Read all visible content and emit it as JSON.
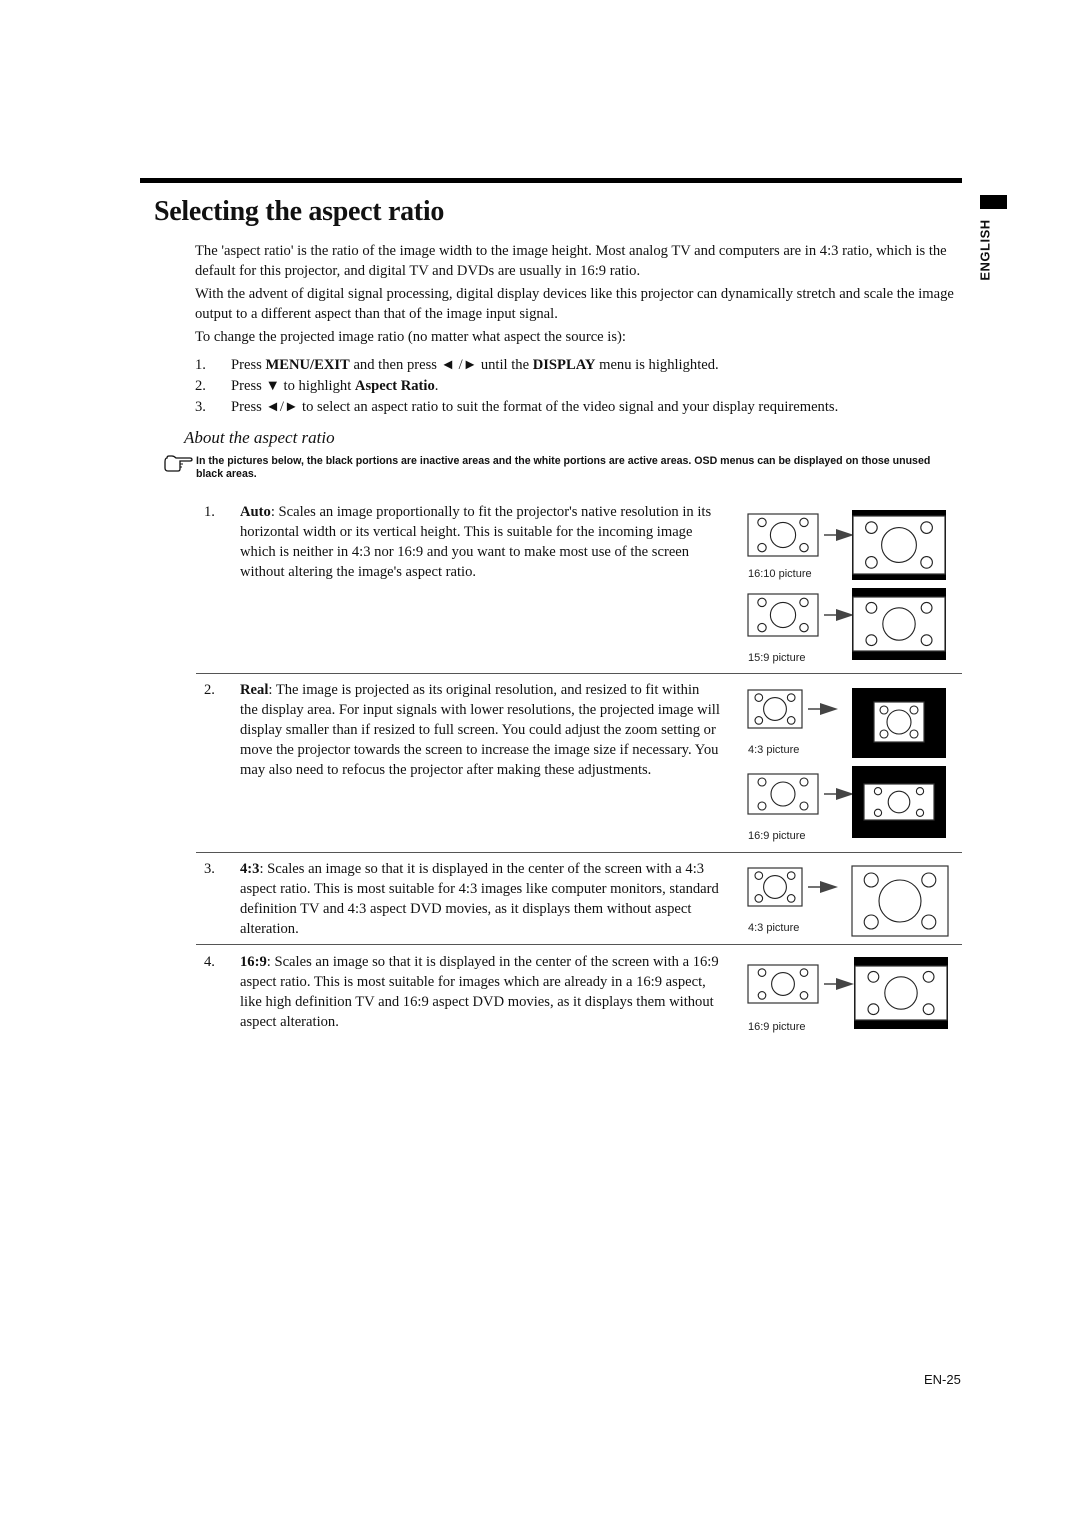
{
  "header": {
    "title": "Selecting the aspect ratio",
    "language_tab": "ENGLISH"
  },
  "intro": {
    "para1": "The 'aspect ratio' is the ratio of the image width to the image height. Most analog TV and computers are in 4:3 ratio, which is the default for this projector, and digital TV and DVDs are usually in 16:9 ratio.",
    "para2": "With the advent of digital signal processing, digital display devices like this projector can dynamically stretch and scale the image output to a different aspect than that of the image input signal.",
    "para3": "To change the projected image ratio (no matter what aspect the source is):"
  },
  "steps": [
    {
      "num": "1.",
      "pre": "Press ",
      "b1": "MENU/EXIT",
      "mid": " and then press ◄ /► until the ",
      "b2": "DISPLAY",
      "post": " menu is highlighted."
    },
    {
      "num": "2.",
      "pre": "Press ▼ to highlight ",
      "b1": "Aspect Ratio",
      "mid": ".",
      "b2": "",
      "post": ""
    },
    {
      "num": "3.",
      "pre": "Press ◄/► to select an aspect ratio to suit the format of the video signal and your display requirements.",
      "b1": "",
      "mid": "",
      "b2": "",
      "post": ""
    }
  ],
  "about": {
    "heading": "About the aspect ratio",
    "note_icon": "pointing-hand-icon",
    "note": "In the pictures below, the black portions are inactive areas and the white portions are active areas. OSD menus can be displayed on those unused black areas."
  },
  "items": [
    {
      "num": "1.",
      "term": "Auto",
      "text": ": Scales an image proportionally to fit the projector's native resolution in its horizontal width or its vertical height. This is suitable for the incoming image which is neither in 4:3 nor 16:9 and you want to make most use of the screen without altering the image's aspect ratio."
    },
    {
      "num": "2.",
      "term": "Real",
      "text": ": The image is projected as its original resolution, and resized to fit within the display area. For input signals with lower resolutions, the projected image will display smaller than if resized to full screen. You could adjust the zoom setting or move the projector towards the screen to increase the image size if necessary. You may also need to refocus the projector after making these adjustments."
    },
    {
      "num": "3.",
      "term": "4:3",
      "text": ": Scales an image so that it is displayed in the center of the screen with a 4:3 aspect ratio. This is most suitable for 4:3 images like computer monitors, standard definition TV and 4:3 aspect DVD movies, as it displays them without aspect alteration."
    },
    {
      "num": "4.",
      "term": "16:9",
      "text": ": Scales an image so that it is displayed in the center of the screen with a 16:9 aspect ratio. This is most suitable for images which are already in a 16:9 aspect, like high definition TV and 16:9 aspect DVD movies, as it displays them without aspect alteration."
    }
  ],
  "figures": [
    {
      "caption": "16:10 picture",
      "result": "letterbox-thin"
    },
    {
      "caption": "15:9 picture",
      "result": "letterbox-thicker"
    },
    {
      "caption": "4:3 picture",
      "result": "real-centered-small"
    },
    {
      "caption": "16:9 picture",
      "result": "real-centered-wide"
    },
    {
      "caption": "4:3 picture",
      "result": "full-4-3"
    },
    {
      "caption": "16:9 picture",
      "result": "letterbox-16-9"
    }
  ],
  "footer": {
    "page_number": "EN-25"
  }
}
